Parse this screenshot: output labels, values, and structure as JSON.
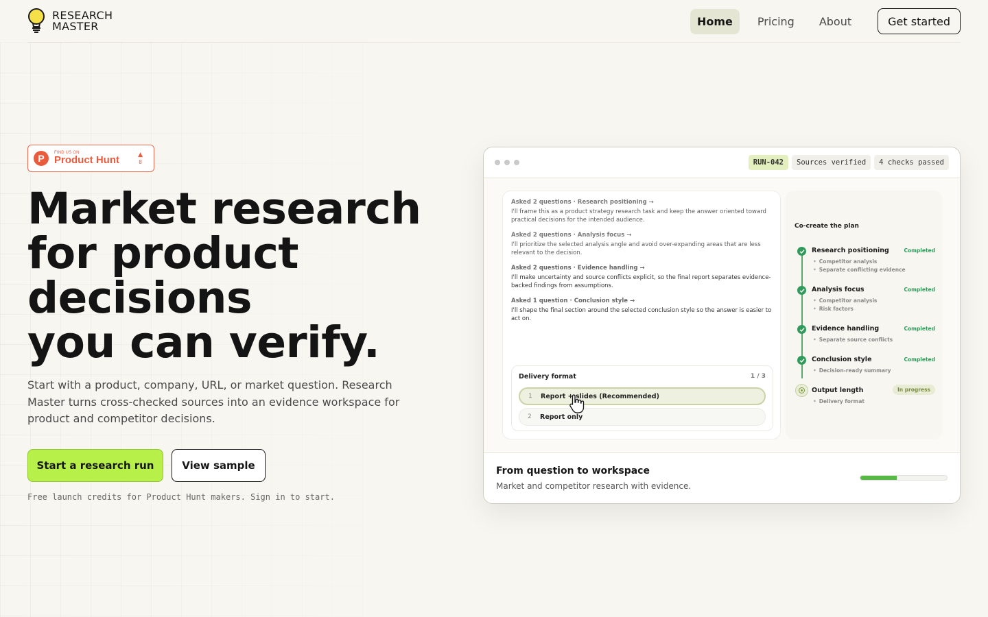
{
  "brand": {
    "line1": "RESEARCH",
    "line2": "MASTER",
    "bulb_color": "#f5e04a"
  },
  "nav": {
    "items": [
      {
        "label": "Home",
        "active": true
      },
      {
        "label": "Pricing",
        "active": false
      },
      {
        "label": "About",
        "active": false
      }
    ],
    "cta": "Get started"
  },
  "product_hunt": {
    "small": "FIND US ON",
    "name": "Product Hunt",
    "letter": "P",
    "votes": "8",
    "color": "#ea5b3d"
  },
  "hero": {
    "title_lines": [
      "Market research",
      "for product",
      "decisions",
      "you can verify."
    ],
    "subtitle": "Start with a product, company, URL, or market question. Research Master turns cross-checked sources into an evidence workspace for product and competitor decisions.",
    "primary_cta": "Start a research run",
    "secondary_cta": "View sample",
    "note": "Free launch credits for Product Hunt makers. Sign in to start."
  },
  "demo": {
    "chips": [
      "RUN-042",
      "Sources verified",
      "4 checks passed"
    ],
    "qa": [
      {
        "heading": "Asked 2 questions · Research positioning →",
        "body": "I'll frame this as a product strategy research task and keep the answer oriented toward practical decisions for the intended audience."
      },
      {
        "heading": "Asked 2 questions · Analysis focus →",
        "body": "I'll prioritize the selected analysis angle and avoid over-expanding areas that are less relevant to the decision."
      },
      {
        "heading": "Asked 2 questions · Evidence handling →",
        "body": "I'll make uncertainty and source conflicts explicit, so the final report separates evidence-backed findings from assumptions."
      },
      {
        "heading": "Asked 1 question · Conclusion style →",
        "body": "I'll shape the final section around the selected conclusion style so the answer is easier to act on."
      }
    ],
    "delivery": {
      "title": "Delivery format",
      "page": "1 / 3",
      "options": [
        {
          "num": "1",
          "label": "Report + slides (Recommended)",
          "selected": true
        },
        {
          "num": "2",
          "label": "Report only",
          "selected": false
        }
      ]
    },
    "plan": {
      "title": "Co-create the plan",
      "steps": [
        {
          "name": "Research positioning",
          "status": "Completed",
          "subs": [
            "Competitor analysis",
            "Separate conflicting evidence"
          ]
        },
        {
          "name": "Analysis focus",
          "status": "Completed",
          "subs": [
            "Competitor analysis",
            "Risk factors"
          ]
        },
        {
          "name": "Evidence handling",
          "status": "Completed",
          "subs": [
            "Separate source conflicts"
          ]
        },
        {
          "name": "Conclusion style",
          "status": "Completed",
          "subs": [
            "Decision-ready summary"
          ]
        },
        {
          "name": "Output length",
          "status": "In progress",
          "subs": [
            "Delivery format"
          ]
        }
      ]
    },
    "footer": {
      "title": "From question to workspace",
      "subtitle": "Market and competitor research with evidence.",
      "progress": 0.42
    }
  },
  "colors": {
    "accent": "#b8f04a",
    "completed": "#2f9a5a",
    "progress": "#57b845"
  }
}
